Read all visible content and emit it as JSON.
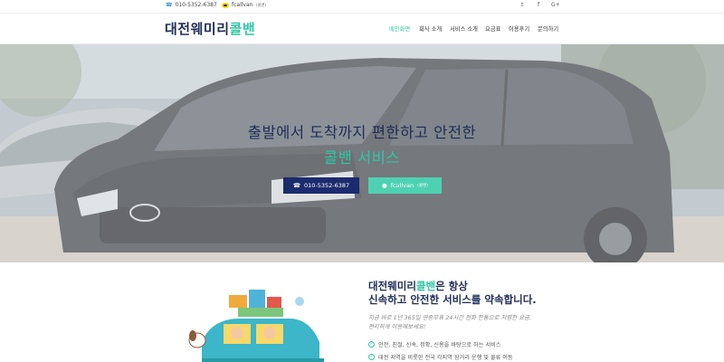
{
  "topbar": {
    "phone": "010-5352-6387",
    "kakao_id": "fcallvan",
    "kakao_suffix": "(콜밴)",
    "social": [
      {
        "name": "twitter-icon",
        "glyph": "t"
      },
      {
        "name": "facebook-icon",
        "glyph": "f"
      },
      {
        "name": "google-plus-icon",
        "glyph": "G+"
      }
    ]
  },
  "header": {
    "logo_main": "대전웨미리",
    "logo_accent": "콜밴",
    "nav": [
      "메인화면",
      "회사 소개",
      "서비스 소개",
      "요금표",
      "이용후기",
      "문의하기"
    ],
    "active_index": 0
  },
  "hero": {
    "line1": "출발에서 도착까지 편한하고 안전한",
    "line2": "콜밴 서비스",
    "phone_button": "010-5352-6387",
    "kakao_button": "fcallvan",
    "kakao_button_suffix": "(콜밴)"
  },
  "intro": {
    "title_main": "대전웨미리",
    "title_accent": "콜밴",
    "title_tail": "은 항상",
    "title_line2": "신속하고 안전한 서비스를 약속합니다.",
    "desc_line1": "지금 바로 1년 365일 연중무휴 24시간 전화 한통으로 저렴한 요금,",
    "desc_line2": "편리하게 이용해보세요!",
    "features": [
      "안전, 친절, 신속, 정확, 신용을 바탕으로 하는 서비스",
      "대전 지역을 비롯한 전국 각지역 장거리 운행 및 물류 이동"
    ]
  },
  "colors": {
    "navy": "#1f2d56",
    "accent": "#2fc6a6",
    "button_navy": "#1c2b6e",
    "button_mint": "#4ed1b2"
  }
}
